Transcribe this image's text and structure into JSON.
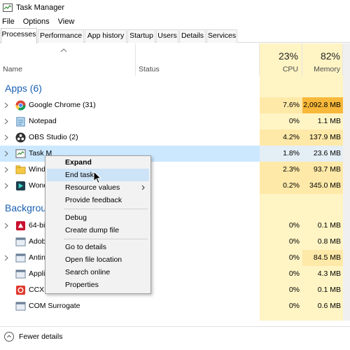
{
  "window": {
    "title": "Task Manager"
  },
  "menu": [
    "File",
    "Options",
    "View"
  ],
  "tabs": [
    "Processes",
    "Performance",
    "App history",
    "Startup",
    "Users",
    "Details",
    "Services"
  ],
  "columns": {
    "name": "Name",
    "status": "Status",
    "cpu_pct": "23%",
    "cpu": "CPU",
    "mem_pct": "82%",
    "memory": "Memory"
  },
  "apps_section": "Apps (6)",
  "background_section": "Backgrou",
  "apps": [
    {
      "name": "Google Chrome (31)",
      "cpu": "7.6%",
      "memory": "2,092.8 MB",
      "icon": "chrome-icon"
    },
    {
      "name": "Notepad",
      "cpu": "0%",
      "memory": "1.1 MB",
      "icon": "notepad-icon"
    },
    {
      "name": "OBS Studio (2)",
      "cpu": "4.2%",
      "memory": "137.9 MB",
      "icon": "obs-icon"
    },
    {
      "name": "Task M",
      "cpu": "1.8%",
      "memory": "23.6 MB",
      "icon": "task-manager-icon"
    },
    {
      "name": "Wind",
      "cpu": "2.3%",
      "memory": "93.7 MB",
      "icon": "explorer-icon"
    },
    {
      "name": "Wond",
      "cpu": "0.2%",
      "memory": "345.0 MB",
      "icon": "wondershare-icon"
    }
  ],
  "background": [
    {
      "name": "64-bi",
      "cpu": "0%",
      "memory": "0.1 MB",
      "icon": "process-icon"
    },
    {
      "name": "Adob",
      "cpu": "0%",
      "memory": "0.8 MB",
      "icon": "process-icon"
    },
    {
      "name": "Antin",
      "cpu": "0%",
      "memory": "84.5 MB",
      "icon": "process-icon"
    },
    {
      "name": "Appli",
      "cpu": "0%",
      "memory": "4.3 MB",
      "icon": "process-icon"
    },
    {
      "name": "CCXP",
      "cpu": "0%",
      "memory": "0.1 MB",
      "icon": "process-icon"
    },
    {
      "name": "COM Surrogate",
      "cpu": "0%",
      "memory": "0.6 MB",
      "icon": "process-icon"
    }
  ],
  "context_menu": [
    "Expand",
    "End task",
    "Resource values",
    "Provide feedback",
    "Debug",
    "Create dump file",
    "Go to details",
    "Open file location",
    "Search online",
    "Properties"
  ],
  "footer": {
    "label": "Fewer details"
  },
  "colors": {
    "accent": "#1a5fb4",
    "heat_light": "#fff4c4",
    "heat_mid": "#ffe9a8",
    "heat_high": "#f8b83a",
    "selection": "#cce8ff"
  }
}
